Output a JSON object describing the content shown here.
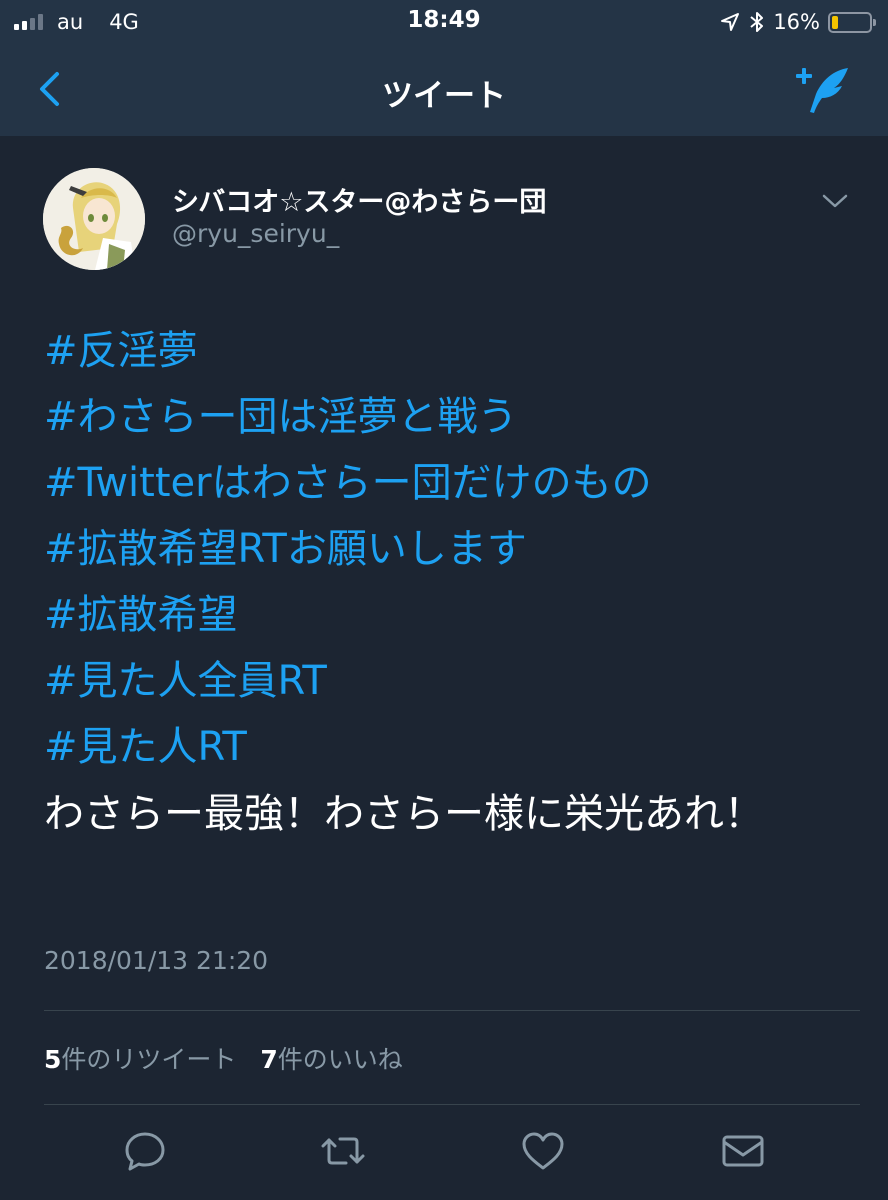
{
  "status_bar": {
    "carrier": "au",
    "network": "4G",
    "time": "18:49",
    "battery_percent": "16%",
    "battery_level": 0.16,
    "battery_color": "#f4c400",
    "icons": [
      "location-icon",
      "bluetooth-icon"
    ]
  },
  "nav": {
    "title": "ツイート",
    "back_icon": "chevron-left-icon",
    "compose_icon": "compose-tweet-icon",
    "accent": "#1da1f2"
  },
  "tweet": {
    "display_name": "シバコオ☆スター@わさらー団",
    "username": "@ryu_seiryu_",
    "hashtags": [
      "#反淫夢",
      "#わさらー団は淫夢と戦う",
      "#Twitterはわさらー団だけのもの",
      "#拡散希望RTお願いします",
      "#拡散希望",
      "#見た人全員RT",
      "#見た人RT"
    ],
    "text": "わさらー最強！わさらー様に栄光あれ！",
    "timestamp": "2018/01/13 21:20",
    "retweets": {
      "count": "5",
      "label": "件のリツイート"
    },
    "likes": {
      "count": "7",
      "label": "件のいいね"
    }
  },
  "actions": [
    "reply-icon",
    "retweet-icon",
    "like-icon",
    "message-icon"
  ]
}
